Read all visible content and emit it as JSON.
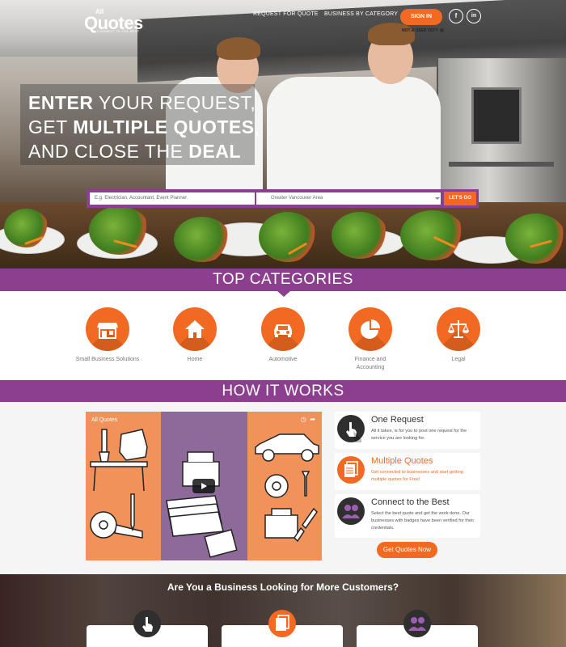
{
  "header": {
    "logo_top": "All",
    "logo_main": "Quotes",
    "logo_tagline": "CONNECT TO THE BEST",
    "nav": [
      "REQUEST FOR QUOTE",
      "BUSINESS BY CATEGORY"
    ],
    "sign_in": "SIGN IN",
    "social": [
      "f",
      "in"
    ],
    "not_user": "NOT A USER YET?"
  },
  "hero": {
    "line1_bold": "ENTER",
    "line1_rest": " YOUR REQUEST,",
    "line2_pre": "GET ",
    "line2_bold": "MULTIPLE QUOTES",
    "line2_post": ",",
    "line3_pre": "AND CLOSE THE ",
    "line3_bold": "DEAL"
  },
  "search": {
    "query_placeholder": "E.g. Electrician, Accountant, Event Planner",
    "location_value": "Greater Vancouver Area",
    "button": "LET'S GO"
  },
  "top_categories": {
    "title": "TOP CATEGORIES",
    "items": [
      {
        "label": "Small Business Solutions",
        "icon": "storefront-icon"
      },
      {
        "label": "Home",
        "icon": "home-icon"
      },
      {
        "label": "Automotive",
        "icon": "car-icon"
      },
      {
        "label": "Finance and Accounting",
        "icon": "pie-chart-icon"
      },
      {
        "label": "Legal",
        "icon": "scales-icon"
      }
    ]
  },
  "how_it_works": {
    "title": "HOW IT WORKS",
    "video_title": "All Quotes",
    "steps": [
      {
        "title": "One Request",
        "desc": "All it takes, is for you to post one request for the service you are looking for.",
        "icon": "hand-pointer-icon"
      },
      {
        "title": "Multiple Quotes",
        "desc": "Get connected to businesses and start getting multiple quotes for Free!",
        "icon": "documents-icon"
      },
      {
        "title": "Connect to the Best",
        "desc": "Select the best quote and get the work done. Our businesses with badges have been verified for their credentials.",
        "icon": "users-icon"
      }
    ],
    "cta": "Get Quotes Now"
  },
  "business": {
    "title": "Are You a Business Looking for More Customers?"
  },
  "colors": {
    "accent": "#f26a21",
    "brand_purple": "#8b3f8e"
  }
}
